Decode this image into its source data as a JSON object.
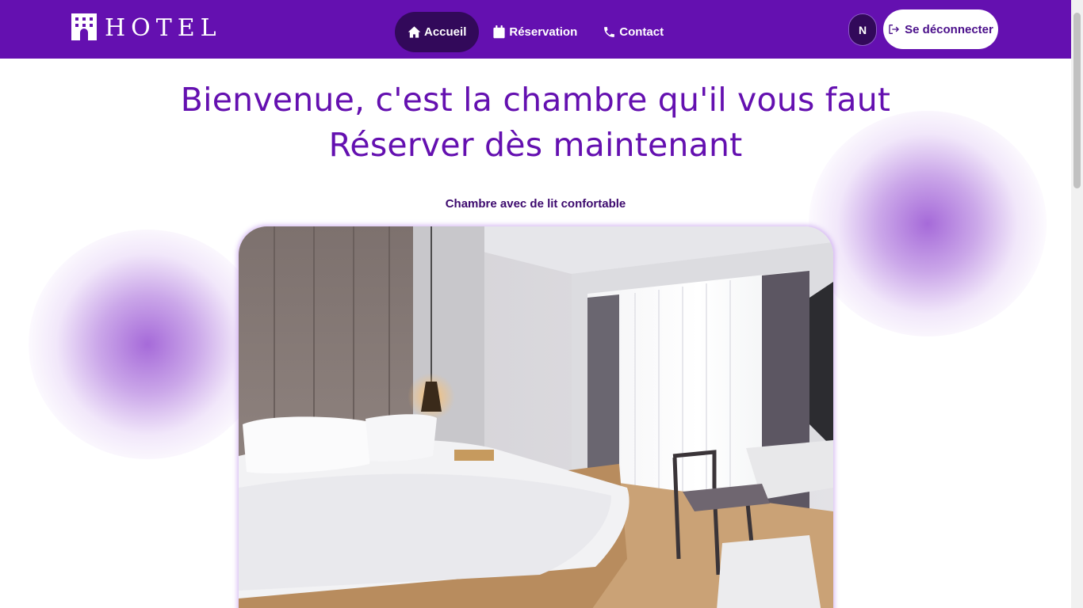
{
  "brand": {
    "logo_text": "HOTEL",
    "logo_icon": "hotel-building-icon"
  },
  "nav": {
    "items": [
      {
        "label": "Accueil",
        "icon": "home-icon",
        "active": true
      },
      {
        "label": "Réservation",
        "icon": "calendar-icon",
        "active": false
      },
      {
        "label": "Contact",
        "icon": "phone-icon",
        "active": false
      }
    ]
  },
  "user": {
    "initial": "N",
    "logout_label": "Se déconnecter",
    "logout_icon": "logout-icon"
  },
  "hero": {
    "line1": "Bienvenue, c'est la chambre qu'il vous faut",
    "line2": "Réserver dès maintenant"
  },
  "room": {
    "caption": "Chambre avec de lit confortable"
  },
  "colors": {
    "primary": "#6410b0",
    "active_nav": "#32095a",
    "caption": "#3d0a6e",
    "glow": "#9650d2"
  }
}
